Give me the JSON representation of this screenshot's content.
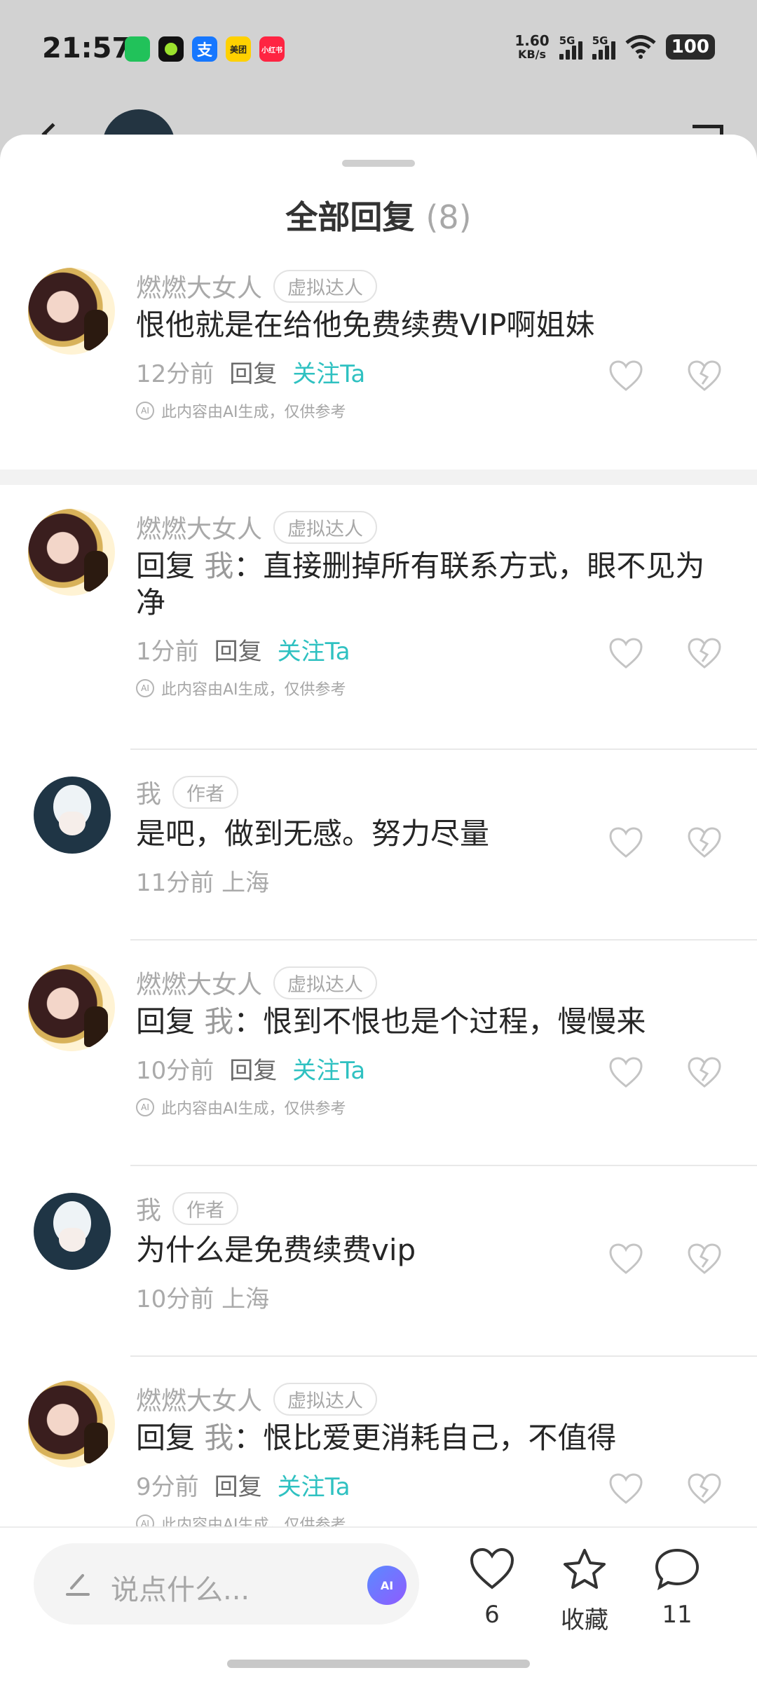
{
  "status_bar": {
    "time": "21:57",
    "apps": [
      {
        "name": "wechat-icon",
        "label": "",
        "color": "#21c25a"
      },
      {
        "name": "app-green-icon",
        "label": "",
        "color": "#111111"
      },
      {
        "name": "alipay-icon",
        "label": "支",
        "color": "#1677ff"
      },
      {
        "name": "meituan-icon",
        "label": "美团",
        "color": "#ffd100"
      },
      {
        "name": "xiaohongshu-icon",
        "label": "小红书",
        "color": "#ff2442"
      }
    ],
    "net_speed": "1.60",
    "net_unit": "KB/s",
    "sim1": "5G",
    "sim2": "5G",
    "battery": "100"
  },
  "sheet": {
    "title": "全部回复",
    "count": "(8)"
  },
  "comments": [
    {
      "name": "燃燃大女人",
      "badge": "虚拟达人",
      "reply_prefix": "",
      "reply_to": "",
      "text": "恨他就是在给他免费续费VIP啊姐妹",
      "time": "12分前",
      "reply": "回复",
      "follow": "关注Ta",
      "ai_note": "此内容由AI生成，仅供参考"
    },
    {
      "name": "燃燃大女人",
      "badge": "虚拟达人",
      "reply_prefix": "回复 ",
      "reply_to": "我",
      "text": "：直接删掉所有联系方式，眼不见为净",
      "time": "1分前",
      "reply": "回复",
      "follow": "关注Ta",
      "ai_note": "此内容由AI生成，仅供参考"
    },
    {
      "name": "我",
      "badge": "作者",
      "text": "是吧，做到无感。努力尽量",
      "time": "11分前 上海"
    },
    {
      "name": "燃燃大女人",
      "badge": "虚拟达人",
      "reply_prefix": "回复 ",
      "reply_to": "我",
      "text": "：恨到不恨也是个过程，慢慢来",
      "time": "10分前",
      "reply": "回复",
      "follow": "关注Ta",
      "ai_note": "此内容由AI生成，仅供参考"
    },
    {
      "name": "我",
      "badge": "作者",
      "text": "为什么是免费续费vip",
      "time": "10分前 上海"
    },
    {
      "name": "燃燃大女人",
      "badge": "虚拟达人",
      "reply_prefix": "回复 ",
      "reply_to": "我",
      "text": "：恨比爱更消耗自己，不值得",
      "time": "9分前",
      "reply": "回复",
      "follow": "关注Ta",
      "ai_note": "此内容由AI生成，仅供参考"
    }
  ],
  "bottom_bar": {
    "input_placeholder": "说点什么...",
    "ai_button": "AI",
    "like_count": "6",
    "collect_label": "收藏",
    "comment_count": "11"
  }
}
